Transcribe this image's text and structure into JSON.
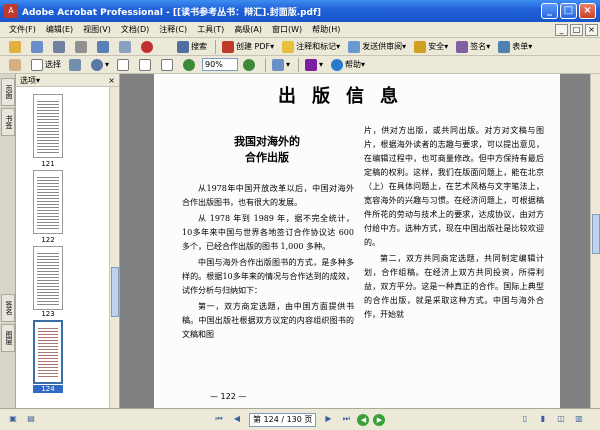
{
  "window": {
    "title": "Adobe Acrobat Professional - [[读书参考丛书：辩汇].封面版.pdf]",
    "minimize": "_",
    "maximize": "□",
    "close": "×"
  },
  "menu": {
    "items": [
      "文件(F)",
      "编辑(E)",
      "视图(V)",
      "文档(D)",
      "注释(C)",
      "工具(T)",
      "高级(A)",
      "窗口(W)",
      "帮助(H)"
    ],
    "doc_controls": [
      "_",
      "□",
      "×"
    ]
  },
  "toolbar1": {
    "search_label": "搜索",
    "create_pdf_label": "创建 PDF",
    "comment_label": "注释和标记",
    "send_review_label": "发送供审阅",
    "secure_label": "安全",
    "sign_label": "签名",
    "forms_label": "表单"
  },
  "toolbar2": {
    "select_label": "选择",
    "zoom_value": "90%",
    "help_label": "帮助"
  },
  "side_tabs": [
    "页面",
    "书签",
    "签名",
    "图层"
  ],
  "thumbnails": {
    "header_label": "选项",
    "pages": [
      {
        "label": "121",
        "selected": false
      },
      {
        "label": "122",
        "selected": false
      },
      {
        "label": "123",
        "selected": false
      },
      {
        "label": "124",
        "selected": true
      }
    ]
  },
  "document": {
    "page_heading": "出版信息",
    "article_title_line1": "我国对海外的",
    "article_title_line2": "合作出版",
    "left_paragraphs": [
      "从1978年中国开放改革以后，中国对海外合作出版图书，也有很大的发展。",
      "从 1978 年到 1989 年，据不完全统计，10多年来中国与世界各地签订合作协议达 600 多个，已经合作出版的图书 1,000 多种。",
      "中国与海外合作出版图书的方式，是多种多样的。根据10多年来的情况与合作达到的成效，试作分析与归纳如下：",
      "第一，双方商定选题，由中国方面提供书稿。中国出版社根据双方议定的内容组织图书的文稿和图"
    ],
    "right_paragraphs": [
      "片，供对方出版，或共同出版。对方对文稿与图片，根据海外读者的志趣与要求，可以提出意见，在编辑过程中，也可商量修改。但中方保持有最后定稿的权利。这样，我们在版面问题上，能在北京（上）在具体问题上，在艺术风格与文字笔法上，宽容海外的兴趣与习惯。在经济问题上，可根据稿件所花的劳动与技术上的要求，达成协议，由对方付给中方。选种方式，现在中国出版社是比较欢迎的。",
      "第二，双方共同商定选题，共同制定编辑计划，合作组稿。在经济上双方共同投资，所得利益，双方平分。这是一种真正的合作。国际上典型的合作出版，就是采取这种方式。中国与海外合作，开始就"
    ],
    "page_number": "— 122 —"
  },
  "statusbar": {
    "page_indicator": "第 124 / 130 页"
  }
}
